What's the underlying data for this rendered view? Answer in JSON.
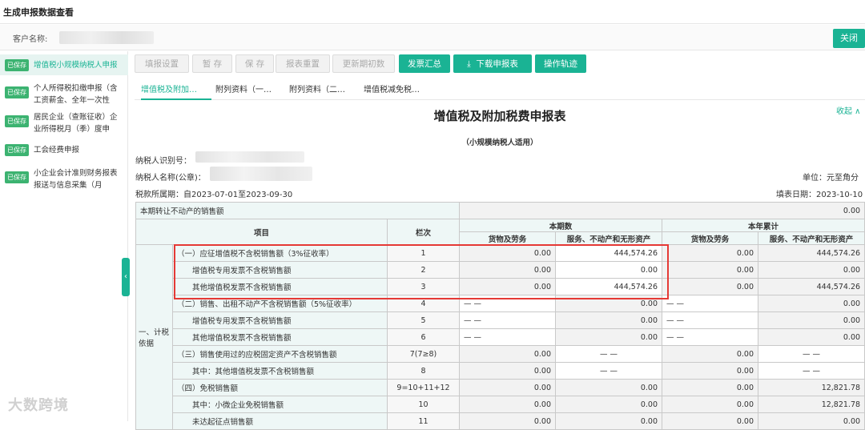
{
  "window": {
    "title": "生成申报数据查看"
  },
  "customer": {
    "label": "客户名称:",
    "close_label": "关闭"
  },
  "sidebar": {
    "items": [
      {
        "badge": "已保存",
        "label": "增值税小规模纳税人申报",
        "active": true
      },
      {
        "badge": "已保存",
        "label": "个人所得税扣缴申报（含工资薪金、全年一次性奖…"
      },
      {
        "badge": "已保存",
        "label": "居民企业（查账征收）企业所得税月（季）度申报…"
      },
      {
        "badge": "已保存",
        "label": "工会经费申报"
      },
      {
        "badge": "已保存",
        "label": "小企业会计准则财务报表报送与信息采集（月季）…"
      }
    ],
    "collapse_icon": "chevron-left-icon"
  },
  "toolbar": {
    "fill_settings": "填报设置",
    "temp_save": "暂 存",
    "save": "保 存",
    "reset": "报表重置",
    "update_init": "更新期初数",
    "invoice_summary": "发票汇总",
    "download_report": "下载申报表",
    "operation_log": "操作轨迹",
    "download_icon": "download-icon"
  },
  "tabs": [
    "增值税及附加…",
    "附列资料（一…",
    "附列资料（二…",
    "增值税减免税…"
  ],
  "document": {
    "title": "增值税及附加税费申报表",
    "subtitle": "（小规模纳税人适用）",
    "collapse_label": "收起 ∧",
    "taxpayer_id_label": "纳税人识别号：",
    "taxpayer_name_label": "纳税人名称(公章)：",
    "unit": "单位：元至角分",
    "period": "税款所属期：自2023-07-01至2023-09-30",
    "fill_date": "填表日期：2023-10-10"
  },
  "table": {
    "transfer_row": {
      "label": "本期转让不动产的销售额",
      "value": "0.00"
    },
    "headers": {
      "item": "项目",
      "line": "栏次",
      "current": "本期数",
      "ytd": "本年累计",
      "goods": "货物及劳务",
      "services": "服务、不动产和无形资产"
    },
    "section_label": "一、计税依据",
    "rows": [
      {
        "item": "（一）应征增值税不含税销售额（3%征收率）",
        "line": "1",
        "cg": "0.00",
        "cs": "444,574.26",
        "yg": "0.00",
        "ys": "444,574.26"
      },
      {
        "item": "增值税专用发票不含税销售额",
        "line": "2",
        "cg": "0.00",
        "cs": "0.00",
        "yg": "0.00",
        "ys": "0.00"
      },
      {
        "item": "其他增值税发票不含税销售额",
        "line": "3",
        "cg": "0.00",
        "cs": "444,574.26",
        "yg": "0.00",
        "ys": "444,574.26"
      },
      {
        "item": "（二）销售、出租不动产不含税销售额（5%征收率）",
        "line": "4",
        "cg": "— —",
        "cs": "0.00",
        "yg": "— —",
        "ys": "0.00"
      },
      {
        "item": "增值税专用发票不含税销售额",
        "line": "5",
        "cg": "— —",
        "cs": "0.00",
        "yg": "— —",
        "ys": "0.00"
      },
      {
        "item": "其他增值税发票不含税销售额",
        "line": "6",
        "cg": "— —",
        "cs": "0.00",
        "yg": "— —",
        "ys": "0.00"
      },
      {
        "item": "（三）销售使用过的应税固定资产不含税销售额",
        "line": "7(7≥8)",
        "cg": "0.00",
        "cs": "— —",
        "yg": "0.00",
        "ys": "— —"
      },
      {
        "item": "其中：其他增值税发票不含税销售额",
        "line": "8",
        "cg": "0.00",
        "cs": "— —",
        "yg": "0.00",
        "ys": "— —"
      },
      {
        "item": "（四）免税销售额",
        "line": "9=10+11+12",
        "cg": "0.00",
        "cs": "0.00",
        "yg": "0.00",
        "ys": "12,821.78"
      },
      {
        "item": "其中：小微企业免税销售额",
        "line": "10",
        "cg": "0.00",
        "cs": "0.00",
        "yg": "0.00",
        "ys": "12,821.78"
      },
      {
        "item": "未达起征点销售额",
        "line": "11",
        "cg": "0.00",
        "cs": "0.00",
        "yg": "0.00",
        "ys": "0.00"
      }
    ]
  },
  "watermark": "大数跨境"
}
